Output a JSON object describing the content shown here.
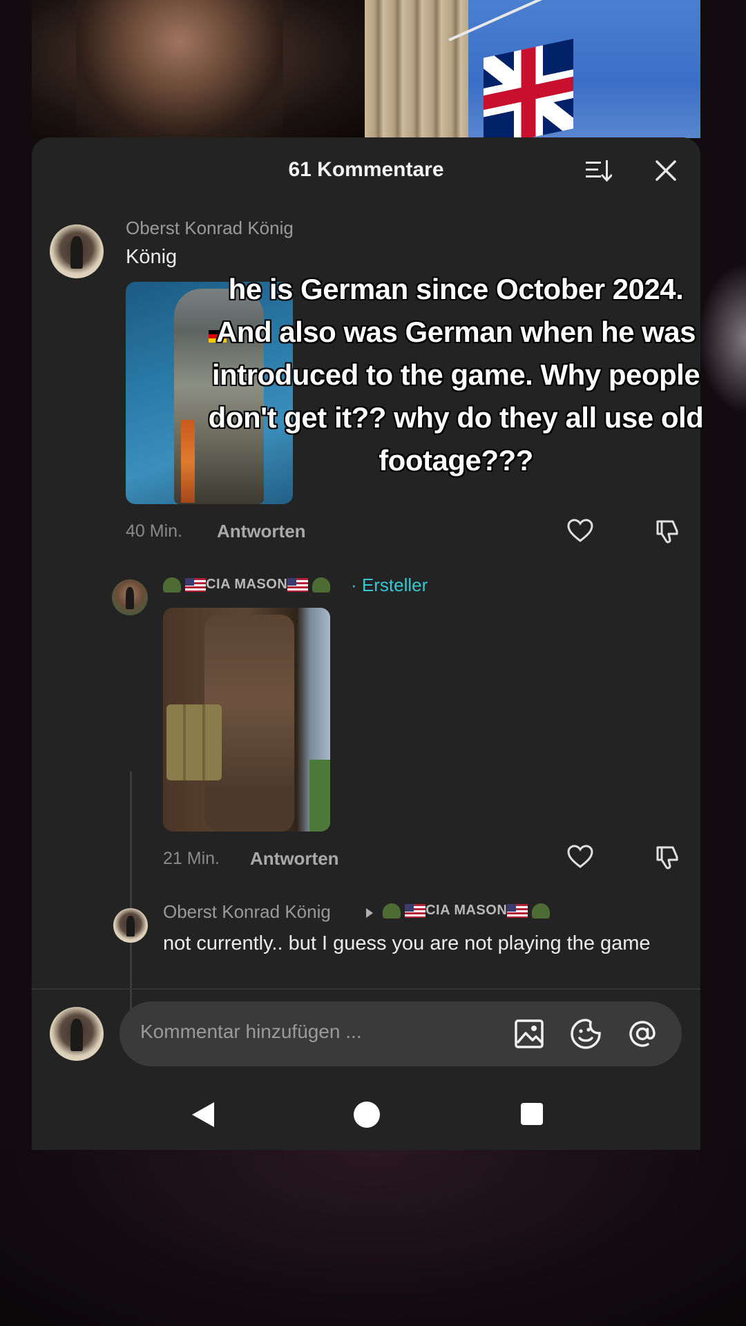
{
  "sheet": {
    "title": "61 Kommentare"
  },
  "comments": [
    {
      "username": "Oberst Konrad König",
      "text": "König",
      "time": "40 Min.",
      "reply_label": "Antworten"
    },
    {
      "username": "CIA MASON",
      "creator_badge": "· Ersteller",
      "time": "21 Min.",
      "reply_label": "Antworten"
    },
    {
      "username": "Oberst Konrad König",
      "reply_to": "CIA MASON",
      "text": "not currently.. but I guess you are not playing the game"
    }
  ],
  "composer": {
    "placeholder": "Kommentar hinzufügen ..."
  },
  "caption": {
    "text": "he is German since October 2024. And also was German when he was introduced to the game. Why people don't get it?? why do they all use old footage???"
  },
  "icons": {
    "sort": "sort-icon",
    "close": "close-icon",
    "like": "heart-icon",
    "dislike": "dislike-icon",
    "image": "image-icon",
    "emoji": "emoji-icon",
    "mention": "at-icon"
  },
  "colors": {
    "sheet_background": "#232323",
    "creator_badge": "#35c8d0"
  }
}
